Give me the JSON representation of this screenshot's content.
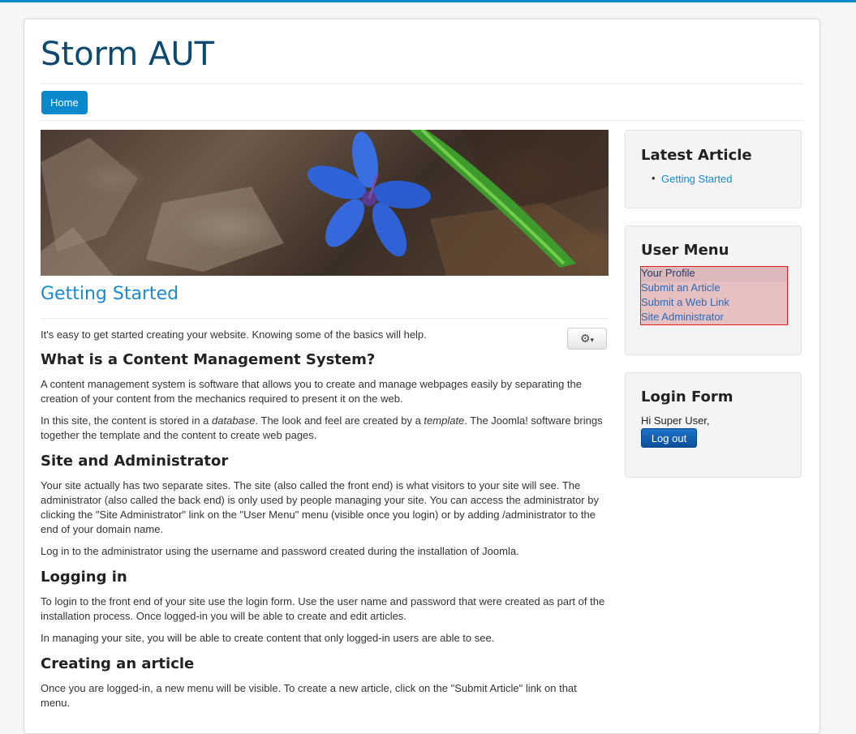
{
  "site": {
    "title": "Storm AUT"
  },
  "nav": {
    "home": "Home"
  },
  "article": {
    "title": "Getting Started",
    "intro": "It's easy to get started creating your website. Knowing some of the basics will help.",
    "s1_title": "What is a Content Management System?",
    "s1_p1": "A content management system is software that allows you to create and manage webpages easily by separating the creation of your content from the mechanics required to present it on the web.",
    "s1_p2_a": "In this site, the content is stored in a ",
    "s1_p2_em1": "database",
    "s1_p2_b": ". The look and feel are created by a ",
    "s1_p2_em2": "template",
    "s1_p2_c": ". The Joomla! software brings together the template and the content to create web pages.",
    "s2_title": "Site and Administrator",
    "s2_p1": "Your site actually has two separate sites. The site (also called the front end) is what visitors to your site will see. The administrator (also called the back end) is only used by people managing your site. You can access the administrator by clicking the \"Site Administrator\" link on the \"User Menu\" menu (visible once you login) or by adding /administrator to the end of your domain name.",
    "s2_p2": "Log in to the administrator using the username and password created during the installation of Joomla.",
    "s3_title": "Logging in",
    "s3_p1": "To login to the front end of your site use the login form. Use the user name and password that were created as part of the installation process. Once logged-in you will be able to create and edit articles.",
    "s3_p2": "In managing your site, you will be able to create content that only logged-in users are able to see.",
    "s4_title": "Creating an article",
    "s4_p1": "Once you are logged-in, a new menu will be visible. To create a new article, click on the \"Submit Article\" link on that menu."
  },
  "sidebar": {
    "latest": {
      "title": "Latest Article",
      "items": [
        "Getting Started"
      ]
    },
    "user_menu": {
      "title": "User Menu",
      "items": [
        "Your Profile",
        "Submit an Article",
        "Submit a Web Link",
        "Site Administrator"
      ]
    },
    "login": {
      "title": "Login Form",
      "greeting": "Hi Super User,",
      "logout": "Log out"
    }
  },
  "icons": {
    "tools": "gear-icon",
    "dropdown": "caret-down-icon"
  },
  "colors": {
    "accent": "#0088cc",
    "title": "#0c4a70",
    "link": "#1a8ad0"
  }
}
